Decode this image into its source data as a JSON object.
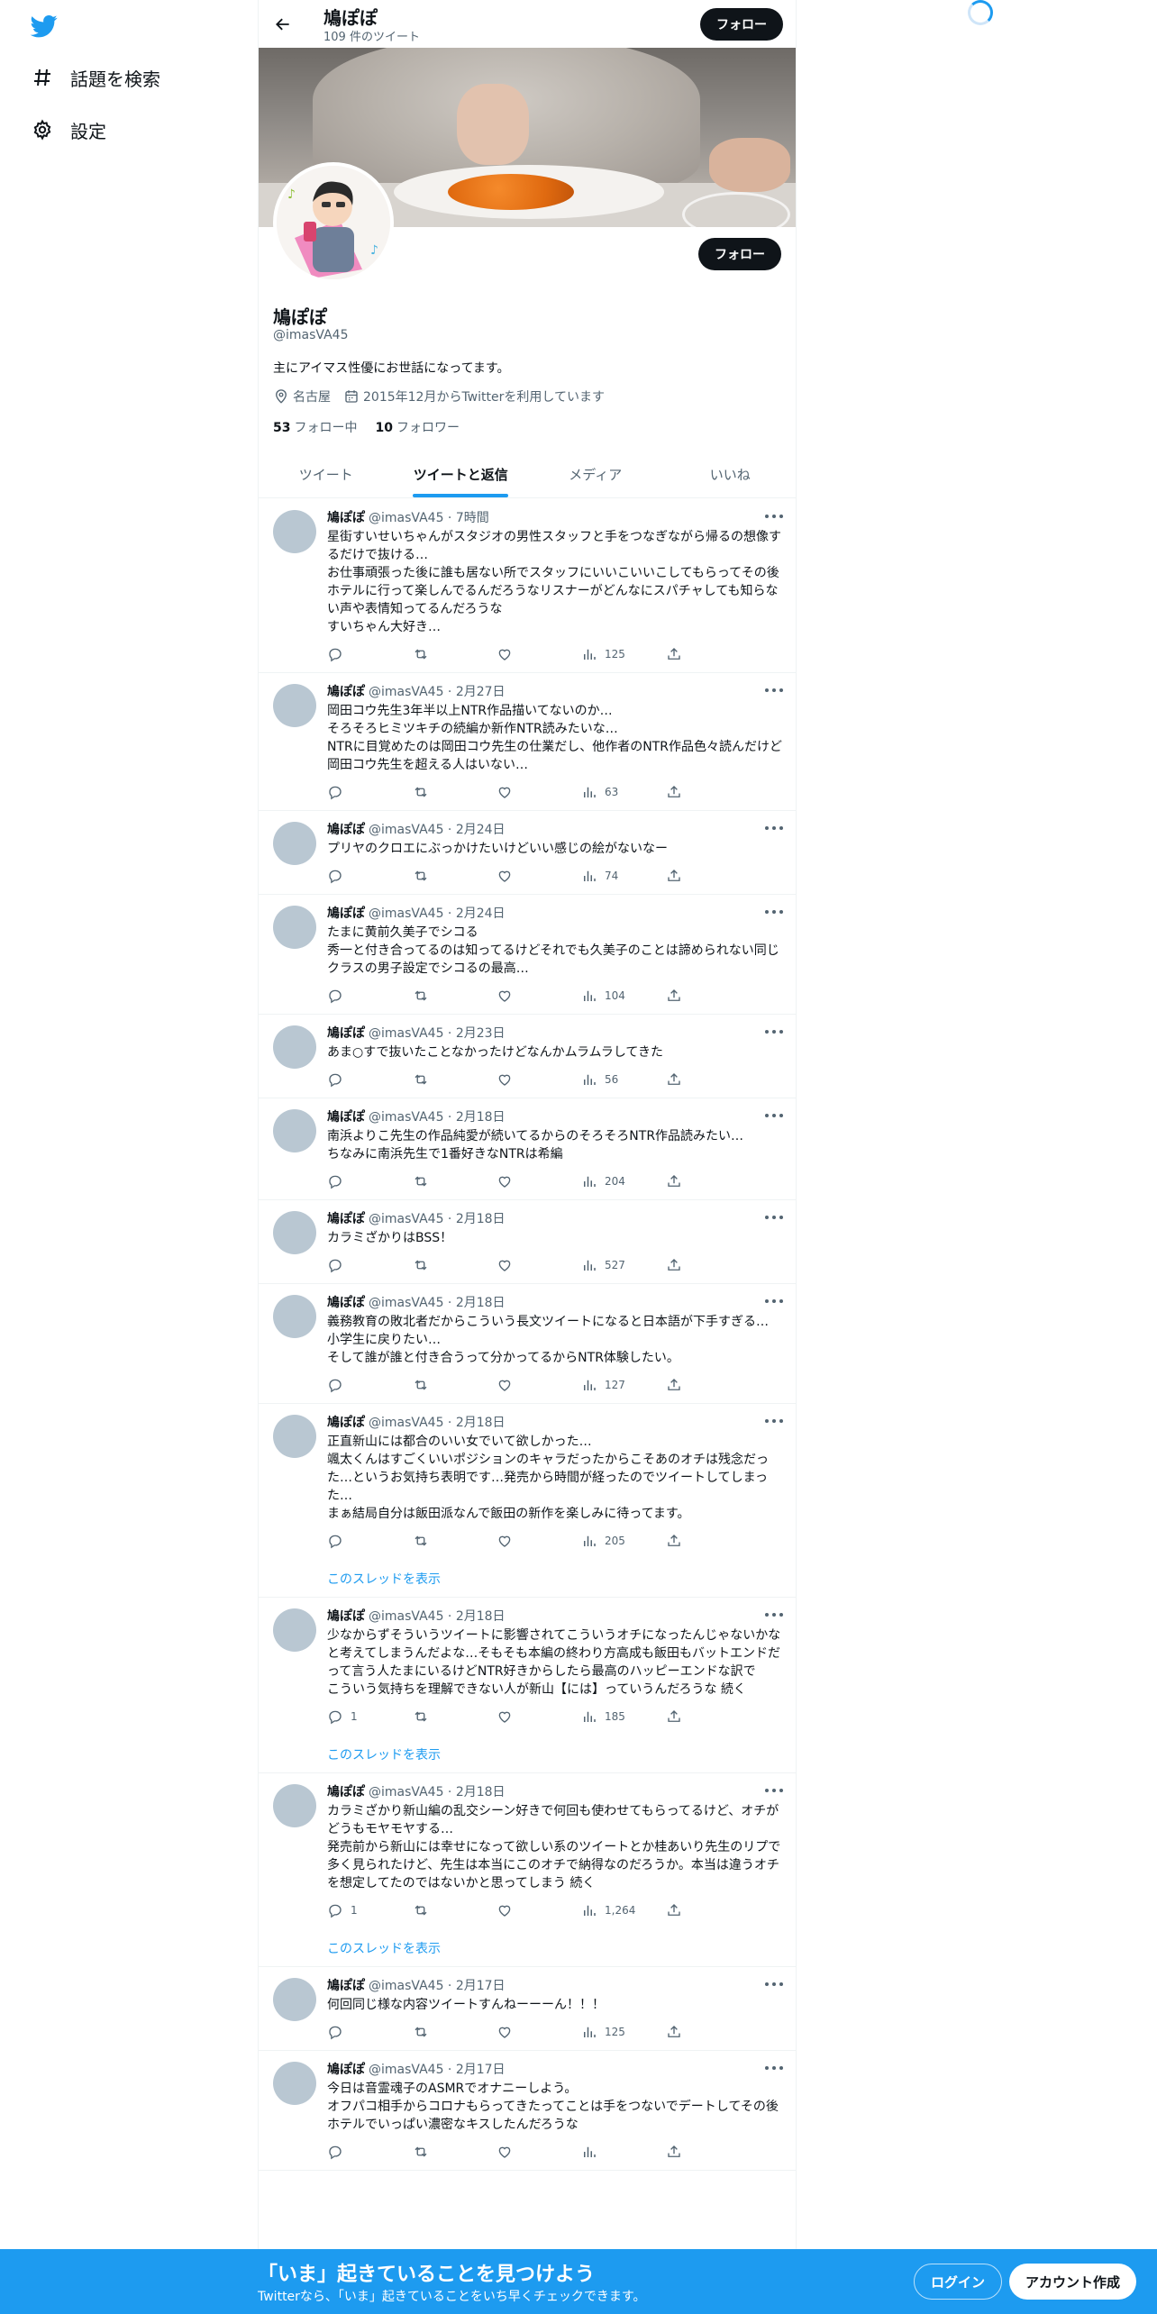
{
  "nav": {
    "logo": "twitter-bird-icon",
    "items": [
      {
        "label": "話題を検索",
        "icon": "hashtag-icon"
      },
      {
        "label": "設定",
        "icon": "gear-icon"
      }
    ]
  },
  "header": {
    "name": "鳩ぽぽ",
    "tweet_count": "109 件のツイート",
    "follow_label": "フォロー"
  },
  "profile": {
    "name": "鳩ぽぽ",
    "handle": "@imasVA45",
    "bio": "主にアイマス性優にお世話になってます。",
    "location": "名古屋",
    "joined": "2015年12月からTwitterを利用しています",
    "following_count": "53",
    "following_label": "フォロー中",
    "followers_count": "10",
    "followers_label": "フォロワー",
    "follow_label": "フォロー"
  },
  "tabs": [
    {
      "label": "ツイート",
      "active": false
    },
    {
      "label": "ツイートと返信",
      "active": true
    },
    {
      "label": "メディア",
      "active": false
    },
    {
      "label": "いいね",
      "active": false
    }
  ],
  "tweets": [
    {
      "name": "鳩ぽぽ",
      "meta": "@imasVA45 · 7時間",
      "text": "星街すいせいちゃんがスタジオの男性スタッフと手をつなぎながら帰るの想像するだけで抜ける…\nお仕事頑張った後に誰も居ない所でスタッフにいいこいいこしてもらってその後ホテルに行って楽しんでるんだろうなリスナーがどんなにスパチャしても知らない声や表情知ってるんだろうな\nすいちゃん大好き…",
      "reply": "",
      "views": "125",
      "thread": ""
    },
    {
      "name": "鳩ぽぽ",
      "meta": "@imasVA45 · 2月27日",
      "text": "岡田コウ先生3年半以上NTR作品描いてないのか…\nそろそろヒミツキチの続編か新作NTR読みたいな…\nNTRに目覚めたのは岡田コウ先生の仕業だし、他作者のNTR作品色々読んだけど岡田コウ先生を超える人はいない…",
      "reply": "",
      "views": "63",
      "thread": ""
    },
    {
      "name": "鳩ぽぽ",
      "meta": "@imasVA45 · 2月24日",
      "text": "プリヤのクロエにぶっかけたいけどいい感じの絵がないなー",
      "reply": "",
      "views": "74",
      "thread": ""
    },
    {
      "name": "鳩ぽぽ",
      "meta": "@imasVA45 · 2月24日",
      "text": "たまに黄前久美子でシコる\n秀一と付き合ってるのは知ってるけどそれでも久美子のことは諦められない同じクラスの男子設定でシコるの最高…",
      "reply": "",
      "views": "104",
      "thread": ""
    },
    {
      "name": "鳩ぽぽ",
      "meta": "@imasVA45 · 2月23日",
      "text": "あま○すで抜いたことなかったけどなんかムラムラしてきた",
      "reply": "",
      "views": "56",
      "thread": ""
    },
    {
      "name": "鳩ぽぽ",
      "meta": "@imasVA45 · 2月18日",
      "text": "南浜よりこ先生の作品純愛が続いてるからのそろそろNTR作品読みたい…\nちなみに南浜先生で1番好きなNTRは希編",
      "reply": "",
      "views": "204",
      "thread": ""
    },
    {
      "name": "鳩ぽぽ",
      "meta": "@imasVA45 · 2月18日",
      "text": "カラミざかりはBSS！",
      "reply": "",
      "views": "527",
      "thread": ""
    },
    {
      "name": "鳩ぽぽ",
      "meta": "@imasVA45 · 2月18日",
      "text": "義務教育の敗北者だからこういう長文ツイートになると日本語が下手すぎる…\n小学生に戻りたい…\nそして誰が誰と付き合うって分かってるからNTR体験したい。",
      "reply": "",
      "views": "127",
      "thread": ""
    },
    {
      "name": "鳩ぽぽ",
      "meta": "@imasVA45 · 2月18日",
      "text": "正直新山には都合のいい女でいて欲しかった…\n颯太くんはすごくいいポジションのキャラだったからこそあのオチは残念だった…というお気持ち表明です…発売から時間が経ったのでツイートしてしまった…\nまぁ結局自分は飯田派なんで飯田の新作を楽しみに待ってます。",
      "reply": "",
      "views": "205",
      "thread": "このスレッドを表示"
    },
    {
      "name": "鳩ぽぽ",
      "meta": "@imasVA45 · 2月18日",
      "text": "少なからずそういうツイートに影響されてこういうオチになったんじゃないかなと考えてしまうんだよな…そもそも本編の終わり方高成も飯田もバットエンドだって言う人たまにいるけどNTR好きからしたら最高のハッピーエンドな訳で\nこういう気持ちを理解できない人が新山【には】っていうんだろうな 続く",
      "reply": "1",
      "views": "185",
      "thread": "このスレッドを表示"
    },
    {
      "name": "鳩ぽぽ",
      "meta": "@imasVA45 · 2月18日",
      "text": "カラミざかり新山編の乱交シーン好きで何回も使わせてもらってるけど、オチがどうもモヤモヤする…\n発売前から新山には幸せになって欲しい系のツイートとか桂あいり先生のリプで多く見られたけど、先生は本当にこのオチで納得なのだろうか。本当は違うオチを想定してたのではないかと思ってしまう 続く",
      "reply": "1",
      "views": "1,264",
      "thread": "このスレッドを表示"
    },
    {
      "name": "鳩ぽぽ",
      "meta": "@imasVA45 · 2月17日",
      "text": "何回同じ様な内容ツイートすんねーーーん！！！",
      "reply": "",
      "views": "125",
      "thread": ""
    },
    {
      "name": "鳩ぽぽ",
      "meta": "@imasVA45 · 2月17日",
      "text": "今日は音霊魂子のASMRでオナニーしよう。\nオフパコ相手からコロナもらってきたってことは手をつないでデートしてその後ホテルでいっぱい濃密なキスしたんだろうな",
      "reply": "",
      "views": "",
      "thread": ""
    }
  ],
  "bottom": {
    "title": "「いま」起きていることを見つけよう",
    "subtitle": "Twitterなら、「いま」起きていることをいち早くチェックできます。",
    "login": "ログイン",
    "signup": "アカウント作成"
  },
  "colors": {
    "accent": "#1d9bf0",
    "text": "#0f1419",
    "muted": "#536471"
  }
}
